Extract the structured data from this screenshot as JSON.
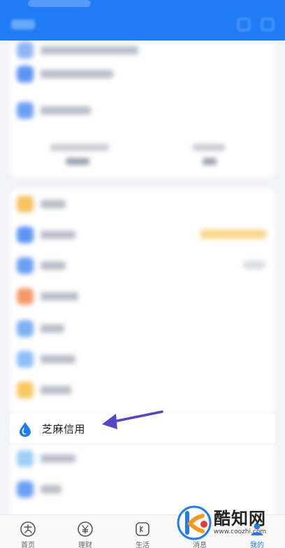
{
  "highlighted_item": {
    "label": "芝麻信用",
    "icon": "zhima-credit-drop-icon"
  },
  "bottom_nav": {
    "items": [
      {
        "label": "首页",
        "icon": "alipay-home-icon"
      },
      {
        "label": "理财",
        "icon": "yuan-wealth-icon"
      },
      {
        "label": "生活",
        "icon": "life-icon"
      },
      {
        "label": "消息",
        "icon": "message-icon"
      },
      {
        "label": "我的",
        "icon": "profile-icon",
        "active": true
      }
    ]
  },
  "watermark": {
    "title": "酷知网",
    "url": "www.coozhi.com"
  },
  "colors": {
    "brand_blue": "#1f7bf6",
    "arrow_purple": "#5446c9",
    "page_bg": "#f2f3f5"
  }
}
